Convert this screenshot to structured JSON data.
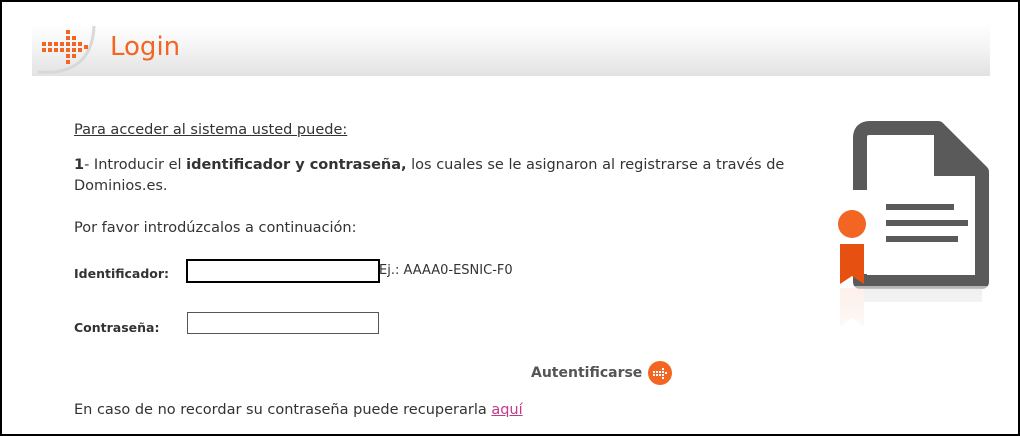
{
  "header": {
    "title": "Login"
  },
  "content": {
    "intro": "Para acceder al sistema usted puede:",
    "step_number": "1",
    "step_text_1": "- Introducir el ",
    "step_bold": "identificador y contraseña,",
    "step_text_2": " los cuales se le asignaron al registrarse a través de Dominios.es.",
    "prompt": "Por favor introdúzcalos a continuación:"
  },
  "form": {
    "identifier_label": "Identificador:",
    "identifier_value": "",
    "identifier_hint": "Ej.: AAAA0-ESNIC-F0",
    "password_label": "Contraseña:",
    "password_value": "",
    "submit_label": "Autentificarse"
  },
  "recover": {
    "text": "En caso de no recordar su contraseña puede recuperarla ",
    "link": "aquí"
  },
  "colors": {
    "accent": "#f26522",
    "link": "#c03a8a",
    "icon_gray": "#555555"
  },
  "icons": {
    "header": "arrow-right-icon",
    "submit": "arrow-right-icon",
    "illustration": "certificate-icon"
  }
}
